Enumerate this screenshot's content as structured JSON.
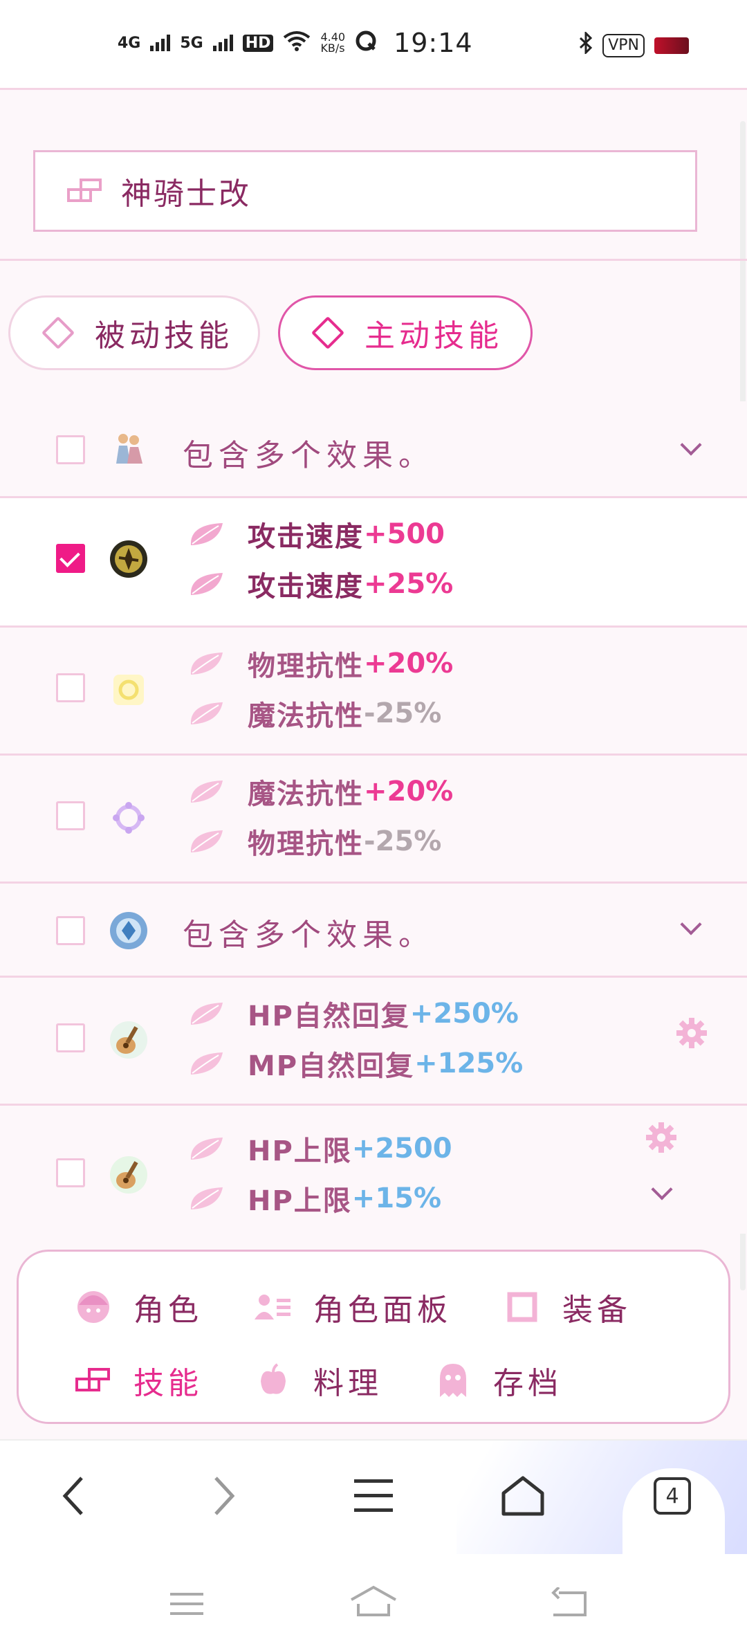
{
  "status_bar": {
    "net1": "4G",
    "net2": "5G",
    "hd": "HD",
    "speed": "4.40",
    "speed_unit": "KB/s",
    "time": "19:14",
    "vpn": "VPN"
  },
  "search": {
    "value": "神骑士改",
    "icon": "skill-icon"
  },
  "tabs": [
    {
      "label": "被动技能",
      "active": false
    },
    {
      "label": "主动技能",
      "active": true
    }
  ],
  "skills": [
    {
      "type": "multi",
      "text": "包含多个效果。",
      "checked": false
    },
    {
      "type": "effects",
      "checked": true,
      "effects": [
        {
          "name": "攻击速度",
          "value": "+500",
          "tone": "pink"
        },
        {
          "name": "攻击速度",
          "value": "+25%",
          "tone": "pink"
        }
      ]
    },
    {
      "type": "effects",
      "checked": false,
      "effects": [
        {
          "name": "物理抗性",
          "value": "+20%",
          "tone": "pink"
        },
        {
          "name": "魔法抗性",
          "value": "-25%",
          "tone": "gray"
        }
      ]
    },
    {
      "type": "effects",
      "checked": false,
      "effects": [
        {
          "name": "魔法抗性",
          "value": "+20%",
          "tone": "pink"
        },
        {
          "name": "物理抗性",
          "value": "-25%",
          "tone": "gray"
        }
      ]
    },
    {
      "type": "multi",
      "text": "包含多个效果。",
      "checked": false
    },
    {
      "type": "effects",
      "checked": false,
      "effects": [
        {
          "name": "HP自然回复",
          "value": "+250%",
          "tone": "blue"
        },
        {
          "name": "MP自然回复",
          "value": "+125%",
          "tone": "blue"
        }
      ]
    },
    {
      "type": "effects",
      "checked": false,
      "effects": [
        {
          "name": "HP上限",
          "value": "+2500",
          "tone": "blue"
        },
        {
          "name": "HP上限",
          "value": "+15%",
          "tone": "blue"
        }
      ]
    }
  ],
  "menu": [
    {
      "label": "角色",
      "icon": "character-face-icon",
      "active": false
    },
    {
      "label": "角色面板",
      "icon": "profile-card-icon",
      "active": false
    },
    {
      "label": "装备",
      "icon": "equipment-square-icon",
      "active": false
    },
    {
      "label": "技能",
      "icon": "skill-icon",
      "active": true
    },
    {
      "label": "料理",
      "icon": "apple-icon",
      "active": false
    },
    {
      "label": "存档",
      "icon": "ghost-icon",
      "active": false
    }
  ],
  "browser": {
    "tab_count": "4"
  },
  "colors": {
    "accent": "#e62c8e",
    "text": "#8a2a62",
    "border": "#eab6d4",
    "positive_pink": "#ec3a93",
    "negative_gray": "#b3a7ad",
    "positive_blue": "#6cb4e8"
  }
}
